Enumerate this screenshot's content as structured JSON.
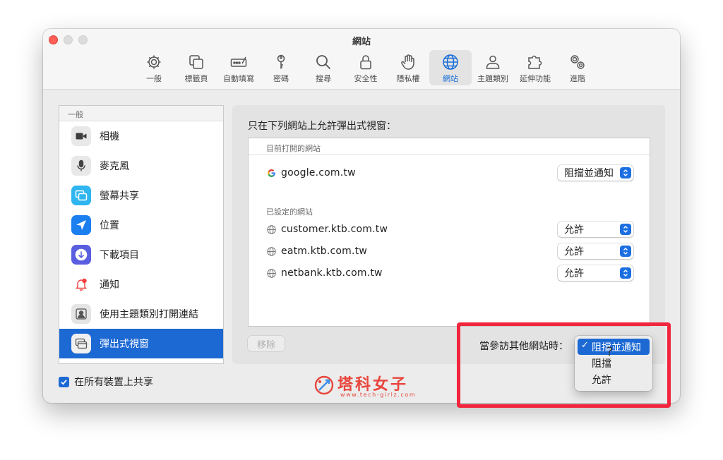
{
  "window": {
    "title": "網站"
  },
  "toolbar": {
    "items": [
      {
        "label": "一般",
        "icon": "gear-icon"
      },
      {
        "label": "標籤頁",
        "icon": "tabs-icon"
      },
      {
        "label": "自動填寫",
        "icon": "autofill-icon"
      },
      {
        "label": "密碼",
        "icon": "key-icon"
      },
      {
        "label": "搜尋",
        "icon": "magnifier-icon"
      },
      {
        "label": "安全性",
        "icon": "lock-icon"
      },
      {
        "label": "隱私權",
        "icon": "hand-icon"
      },
      {
        "label": "網站",
        "icon": "globe-icon",
        "selected": true
      },
      {
        "label": "主題類別",
        "icon": "person-icon"
      },
      {
        "label": "延伸功能",
        "icon": "puzzle-icon"
      },
      {
        "label": "進階",
        "icon": "gears-icon"
      }
    ]
  },
  "sidebar": {
    "header": "一般",
    "items": [
      {
        "label": "相機",
        "icon": "camera-icon",
        "color": "#5b5b5b"
      },
      {
        "label": "麥克風",
        "icon": "microphone-icon",
        "color": "#6a6a6a"
      },
      {
        "label": "螢幕共享",
        "icon": "screen-share-icon",
        "color": "#2fb5f0"
      },
      {
        "label": "位置",
        "icon": "location-arrow-icon",
        "color": "#1c7ff0"
      },
      {
        "label": "下載項目",
        "icon": "download-icon",
        "color": "#5a5fe0"
      },
      {
        "label": "通知",
        "icon": "bell-icon",
        "color": "#f04040"
      },
      {
        "label": "使用主題類別打開連結",
        "icon": "contact-card-icon",
        "color": "#8a8a8a"
      },
      {
        "label": "彈出式視窗",
        "icon": "popup-window-icon",
        "color": "#7a7a7a",
        "selected": true
      }
    ]
  },
  "share": {
    "label": "在所有裝置上共享",
    "checked": true
  },
  "main": {
    "heading": "只在下列網站上允許彈出式視窗：",
    "open_sites_header": "目前打開的網站",
    "configured_header": "已設定的網站",
    "open_sites": [
      {
        "domain": "google.com.tw",
        "setting": "阻擋並通知",
        "icon": "google-icon"
      }
    ],
    "configured_sites": [
      {
        "domain": "customer.ktb.com.tw",
        "setting": "允許",
        "icon": "globe-icon"
      },
      {
        "domain": "eatm.ktb.com.tw",
        "setting": "允許",
        "icon": "globe-icon"
      },
      {
        "domain": "netbank.ktb.com.tw",
        "setting": "允許",
        "icon": "globe-icon"
      }
    ],
    "remove_label": "移除",
    "other_sites_label": "當參訪其他網站時：",
    "dropdown_options": [
      "阻擋並通知",
      "阻擋",
      "允許"
    ],
    "dropdown_selected": "阻擋並通知",
    "help": "?"
  },
  "watermark": {
    "title": "塔科女子",
    "url": "www.tech-girlz.com"
  },
  "colors": {
    "accent": "#1c69d4",
    "highlight": "#f1263d"
  }
}
